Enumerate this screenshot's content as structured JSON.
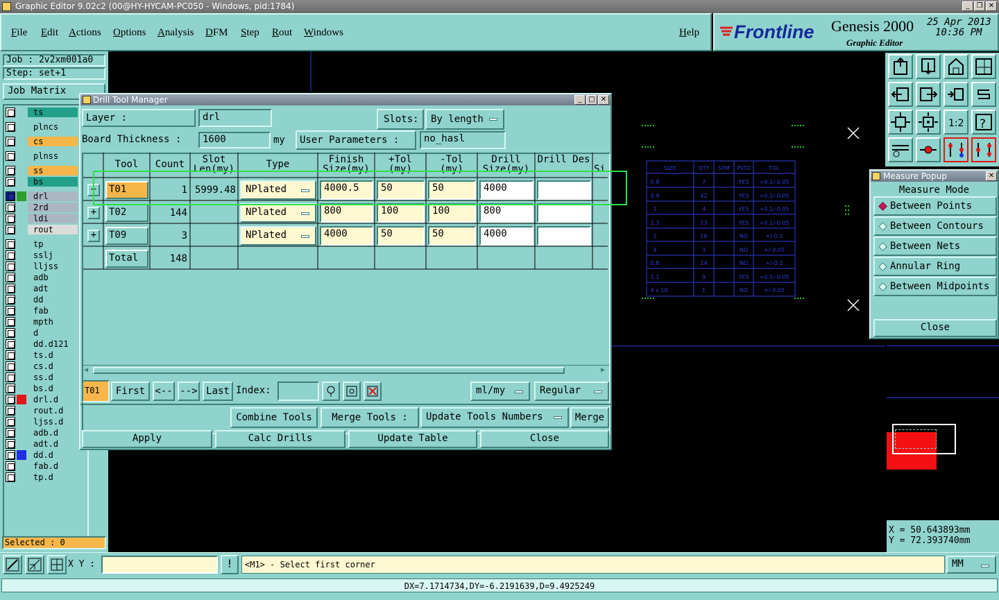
{
  "window": {
    "title": "Graphic Editor 9.02c2 (00@HY-HYCAM-PC050 - Windows, pid:1784)"
  },
  "menu": [
    "File",
    "Edit",
    "Actions",
    "Options",
    "Analysis",
    "DFM",
    "Step",
    "Rout",
    "Windows"
  ],
  "help": "Help",
  "brand": {
    "logo": "Frontline",
    "product": "Genesis 2000",
    "subtitle": "Graphic Editor",
    "date": "25 Apr 2013",
    "time": "10:36 PM"
  },
  "job": {
    "job": "Job : 2v2xm001a0",
    "step": "Step: set+1",
    "matrix_button": "Job Matrix"
  },
  "layers": [
    {
      "name": "ts",
      "color": "#23a08a"
    },
    {
      "name": "plncs",
      "color": "#8fd3cc"
    },
    {
      "name": "cs",
      "color": "#f6b64a"
    },
    {
      "name": "plnss",
      "color": "#8fd3cc"
    },
    {
      "name": "ss",
      "color": "#f6b64a"
    },
    {
      "name": "bs",
      "color": "#23a08a"
    },
    {
      "name": "drl",
      "color": "#aab7c3"
    },
    {
      "name": "2rd",
      "color": "#aab7c3"
    },
    {
      "name": "ldi",
      "color": "#aab7c3"
    },
    {
      "name": "rout",
      "color": "#dcdcdc"
    },
    {
      "name": "tp",
      "color": "#8fd3cc"
    },
    {
      "name": "sslj",
      "color": "#8fd3cc"
    },
    {
      "name": "lljss",
      "color": "#8fd3cc"
    },
    {
      "name": "adb",
      "color": "#8fd3cc"
    },
    {
      "name": "adt",
      "color": "#8fd3cc"
    },
    {
      "name": "dd",
      "color": "#8fd3cc"
    },
    {
      "name": "fab",
      "color": "#8fd3cc"
    },
    {
      "name": "mpth",
      "color": "#8fd3cc"
    },
    {
      "name": "d",
      "color": "#8fd3cc"
    },
    {
      "name": "dd.d121",
      "color": "#8fd3cc"
    },
    {
      "name": "ts.d",
      "color": "#8fd3cc"
    },
    {
      "name": "cs.d",
      "color": "#8fd3cc"
    },
    {
      "name": "ss.d",
      "color": "#8fd3cc"
    },
    {
      "name": "bs.d",
      "color": "#8fd3cc"
    },
    {
      "name": "drl.d",
      "color": "#8fd3cc"
    },
    {
      "name": "rout.d",
      "color": "#8fd3cc"
    },
    {
      "name": "ljss.d",
      "color": "#8fd3cc"
    },
    {
      "name": "adb.d",
      "color": "#8fd3cc"
    },
    {
      "name": "adt.d",
      "color": "#8fd3cc"
    },
    {
      "name": "dd.d",
      "color": "#8fd3cc"
    },
    {
      "name": "fab.d",
      "color": "#8fd3cc"
    },
    {
      "name": "tp.d",
      "color": "#8fd3cc"
    }
  ],
  "selected": "Selected : 0",
  "dtm": {
    "title": "Drill Tool Manager",
    "layer_label": "Layer :",
    "layer_value": "drl",
    "slots_label": "Slots:",
    "slots_value": "By length",
    "board_label": "Board Thickness :",
    "board_value": "1600",
    "board_unit": "my",
    "user_params_label": "User Parameters :",
    "user_params_value": "no_hasl",
    "columns": [
      "Tool",
      "Count",
      "Slot Len(my)",
      "Type",
      "Finish Size(my)",
      "+Tol (my)",
      "-Tol (my)",
      "Drill Size(my)",
      "Drill Des",
      "Si"
    ],
    "rows": [
      {
        "tool": "T01",
        "count": "1",
        "slot": "5999.48",
        "type": "NPlated",
        "finish": "4000.5",
        "ptol": "50",
        "ntol": "50",
        "drill": "4000",
        "des": ""
      },
      {
        "tool": "T02",
        "count": "144",
        "slot": "",
        "type": "NPlated",
        "finish": "800",
        "ptol": "100",
        "ntol": "100",
        "drill": "800",
        "des": ""
      },
      {
        "tool": "T09",
        "count": "3",
        "slot": "",
        "type": "NPlated",
        "finish": "4000",
        "ptol": "50",
        "ntol": "50",
        "drill": "4000",
        "des": ""
      }
    ],
    "total_label": "Total",
    "total_count": "148",
    "current_tool": "T01",
    "nav": {
      "first": "First",
      "prev": "<--",
      "next": "-->",
      "last": "Last",
      "index_label": "Index:"
    },
    "units": "ml/my",
    "mode": "Regular",
    "combine": "Combine Tools",
    "merge_label": "Merge Tools :",
    "update_numbers": "Update Tools Numbers",
    "merge": "Merge",
    "apply": "Apply",
    "calc": "Calc Drills",
    "update_table": "Update Table",
    "close": "Close"
  },
  "measure": {
    "title": "Measure Popup",
    "mode_label": "Measure Mode",
    "modes": [
      "Between Points",
      "Between Contours",
      "Between Nets",
      "Annular Ring",
      "Between Midpoints"
    ],
    "selected_index": 0,
    "close": "Close"
  },
  "drill_table": {
    "headers": [
      "SIZE",
      "QTY",
      "SYM",
      "PLTD",
      "TOL"
    ],
    "rows": [
      [
        "0.8",
        "7",
        "YES",
        "+0.1/-0.05"
      ],
      [
        "0.9",
        "42",
        "YES",
        "+0.1/-0.05"
      ],
      [
        "1",
        "4",
        "YES",
        "+0.1/-0.05"
      ],
      [
        "1.3",
        "13",
        "YES",
        "+0.1/-0.05"
      ],
      [
        "2",
        "16",
        "NO",
        "+/-0.1"
      ],
      [
        "4",
        "3",
        "NO",
        "+/-0.05"
      ],
      [
        "0.8",
        "24",
        "NO",
        "+/-0.1"
      ],
      [
        "1.1",
        "9",
        "YES",
        "+0.1/-0.05"
      ],
      [
        "4 x 10",
        "1",
        "NO",
        "+/-0.05"
      ]
    ]
  },
  "coords": {
    "x": "X  =  50.643893mm",
    "y": "Y  =  72.393740mm"
  },
  "status": {
    "xy_label": "X Y :",
    "prompt": "<M1> - Select first corner",
    "unit": "MM",
    "measure": "DX=7.1714734,DY=-6.2191639,D=9.4925249"
  }
}
